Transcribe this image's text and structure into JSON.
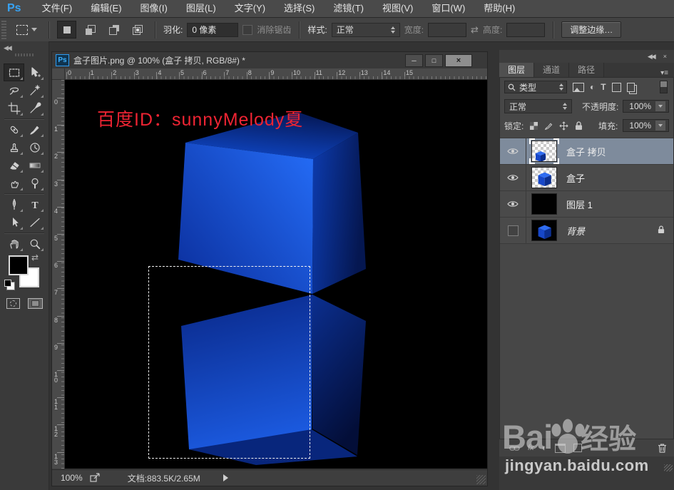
{
  "app": {
    "logo": "Ps"
  },
  "menus": [
    "文件(F)",
    "编辑(E)",
    "图像(I)",
    "图层(L)",
    "文字(Y)",
    "选择(S)",
    "滤镜(T)",
    "视图(V)",
    "窗口(W)",
    "帮助(H)"
  ],
  "options": {
    "feather_label": "羽化:",
    "feather_value": "0 像素",
    "antialias_label": "消除锯齿",
    "style_label": "样式:",
    "style_value": "正常",
    "width_label": "宽度:",
    "width_value": "",
    "height_label": "高度:",
    "height_value": "",
    "refine_edge_label": "调整边缘…",
    "swap_glyph": "⇄"
  },
  "tools": [
    {
      "name": "rectangular-marquee-tool",
      "selected": true
    },
    {
      "name": "move-tool"
    },
    {
      "name": "lasso-tool"
    },
    {
      "name": "magic-wand-tool"
    },
    {
      "name": "crop-tool"
    },
    {
      "name": "eyedropper-tool"
    },
    {
      "name": "healing-brush-tool"
    },
    {
      "name": "brush-tool"
    },
    {
      "name": "clone-stamp-tool"
    },
    {
      "name": "history-brush-tool"
    },
    {
      "name": "eraser-tool"
    },
    {
      "name": "gradient-tool"
    },
    {
      "name": "smudge-tool"
    },
    {
      "name": "dodge-tool"
    },
    {
      "name": "pen-tool"
    },
    {
      "name": "type-tool"
    },
    {
      "name": "path-selection-tool"
    },
    {
      "name": "line-tool"
    },
    {
      "name": "hand-tool"
    },
    {
      "name": "zoom-tool"
    }
  ],
  "tool_dividers_after_row": [
    2,
    6,
    8
  ],
  "document": {
    "title": "盒子图片.png @ 100% (盒子 拷贝, RGB/8#) *",
    "window_controls": [
      "─",
      "□",
      "×"
    ],
    "ruler_h": [
      "0",
      "1",
      "2",
      "3",
      "4",
      "5",
      "6",
      "7",
      "8",
      "9",
      "10",
      "11",
      "12",
      "13",
      "14",
      "15"
    ],
    "ruler_v": [
      "0",
      "1",
      "2",
      "3",
      "4",
      "5",
      "6",
      "7",
      "8",
      "9",
      "10",
      "11",
      "12",
      "13"
    ],
    "canvas_note": "百度ID：sunnyMelody夏",
    "status_zoom": "100%",
    "status_doc": "文档:883.5K/2.65M"
  },
  "panel": {
    "tabs": [
      {
        "label": "图层",
        "active": true
      },
      {
        "label": "通道",
        "active": false
      },
      {
        "label": "路径",
        "active": false
      }
    ],
    "filter_label": "类型",
    "blend_mode": "正常",
    "opacity_label": "不透明度:",
    "opacity_value": "100%",
    "lock_label": "锁定:",
    "fill_label": "填充:",
    "fill_value": "100%",
    "layers": [
      {
        "name": "盒子 拷贝",
        "visible": true,
        "selected": true,
        "locked": false,
        "italic": false,
        "thumb": "checker-cube-corner"
      },
      {
        "name": "盒子",
        "visible": true,
        "selected": false,
        "locked": false,
        "italic": false,
        "thumb": "checker-cube"
      },
      {
        "name": "图层 1",
        "visible": true,
        "selected": false,
        "locked": false,
        "italic": false,
        "thumb": "black"
      },
      {
        "name": "背景",
        "visible": false,
        "selected": false,
        "locked": true,
        "italic": true,
        "thumb": "black-cube"
      }
    ]
  },
  "watermark": {
    "brand_prefix": "Bai",
    "brand_suffix": "经验",
    "url": "jingyan.baidu.com"
  },
  "colors": {
    "accent_blue": "#37a3f5",
    "note_red": "#ee2433",
    "layer_selected": "#7e8b9c",
    "cube_bright": "#2369f2",
    "cube_dark": "#051751",
    "canvas_bg": "#000000"
  }
}
